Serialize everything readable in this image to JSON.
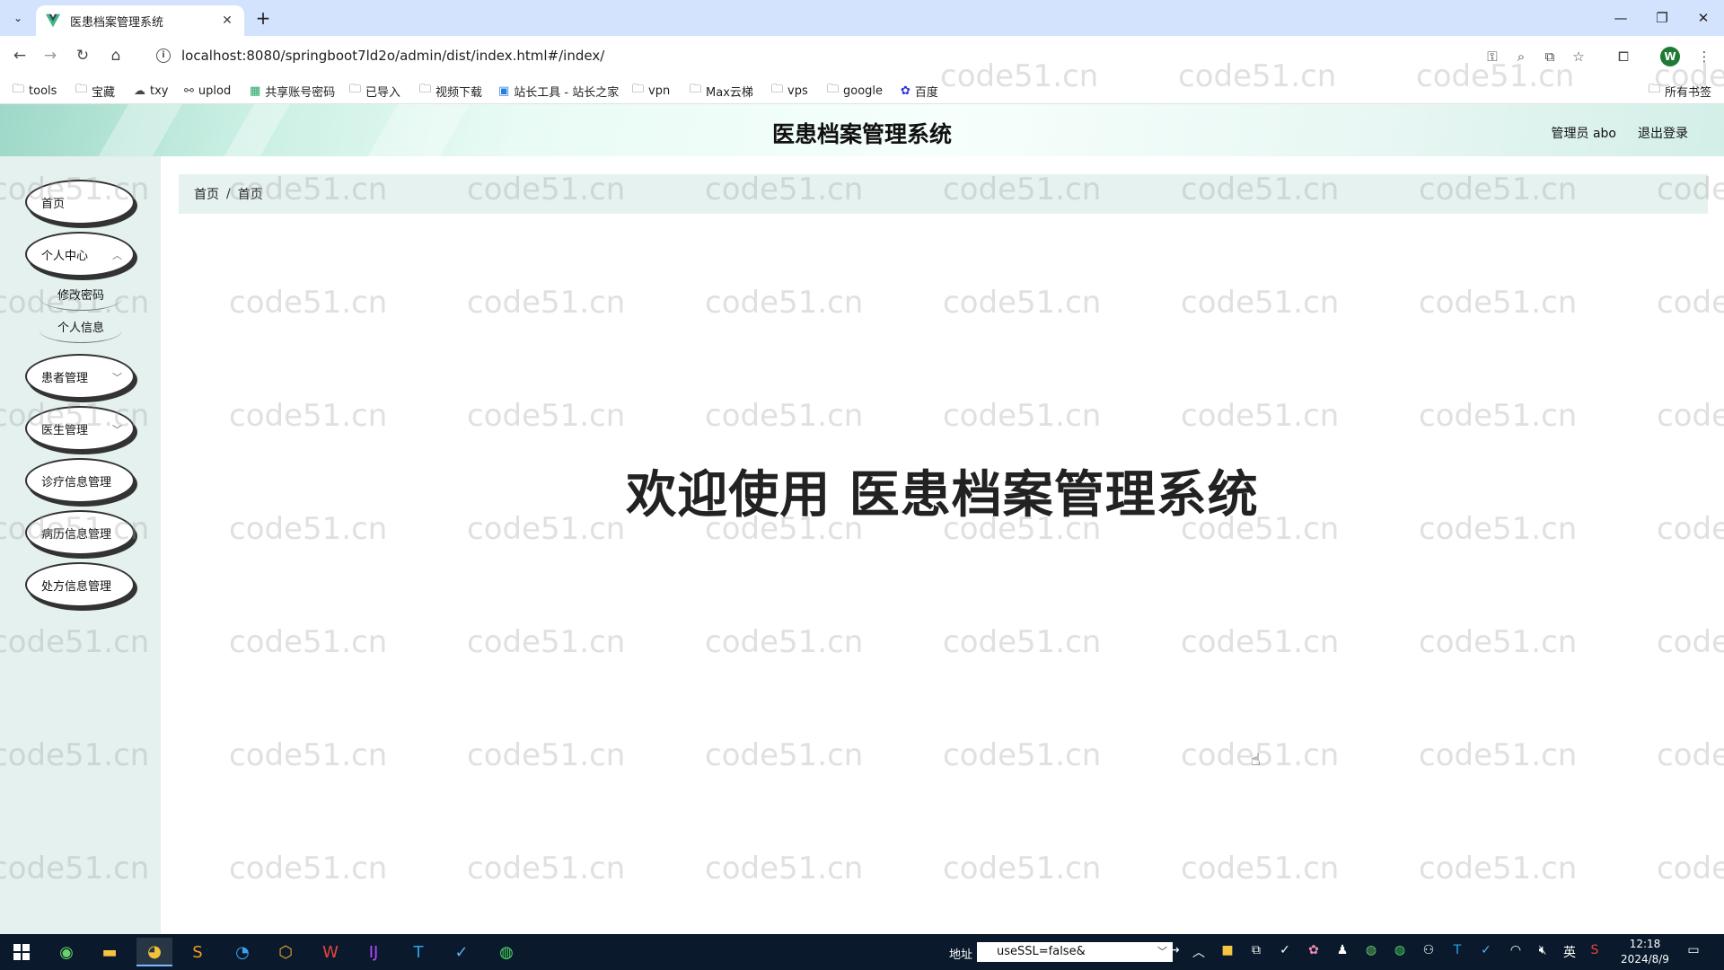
{
  "browser": {
    "tab_title": "医患档案管理系统",
    "url": "localhost:8080/springboot7ld2o/admin/dist/index.html#/index/",
    "profile_initial": "W"
  },
  "bookmarks": [
    {
      "label": "tools",
      "icon": "folder-icon"
    },
    {
      "label": "宝藏",
      "icon": "folder-icon"
    },
    {
      "label": "txy",
      "icon": "cloud-icon"
    },
    {
      "label": "uplod",
      "icon": "share-icon"
    },
    {
      "label": "共享账号密码",
      "icon": "sheet-icon"
    },
    {
      "label": "已导入",
      "icon": "folder-icon"
    },
    {
      "label": "视频下载",
      "icon": "folder-icon"
    },
    {
      "label": "站长工具 - 站长之家",
      "icon": "site-icon"
    },
    {
      "label": "vpn",
      "icon": "folder-icon"
    },
    {
      "label": "Max云梯",
      "icon": "folder-icon"
    },
    {
      "label": "vps",
      "icon": "folder-icon"
    },
    {
      "label": "google",
      "icon": "folder-icon"
    },
    {
      "label": "百度",
      "icon": "baidu-icon"
    }
  ],
  "bookmarks_all": "所有书签",
  "header": {
    "title": "医患档案管理系统",
    "user": "管理员 abo",
    "logout": "退出登录"
  },
  "sidebar": {
    "home": "首页",
    "personal_center": "个人中心",
    "change_password": "修改密码",
    "personal_info": "个人信息",
    "patient_mgmt": "患者管理",
    "doctor_mgmt": "医生管理",
    "diagnosis_mgmt": "诊疗信息管理",
    "record_mgmt": "病历信息管理",
    "prescription_mgmt": "处方信息管理"
  },
  "breadcrumb": {
    "root": "首页",
    "separator": "/",
    "current": "首页"
  },
  "main": {
    "welcome": "欢迎使用 医患档案管理系统"
  },
  "watermark_text": "code51.cn",
  "taskbar": {
    "address_label": "地址",
    "address_value": "useSSL=false&",
    "clock_time": "12:18",
    "clock_date": "2024/8/9",
    "ime": "英"
  }
}
